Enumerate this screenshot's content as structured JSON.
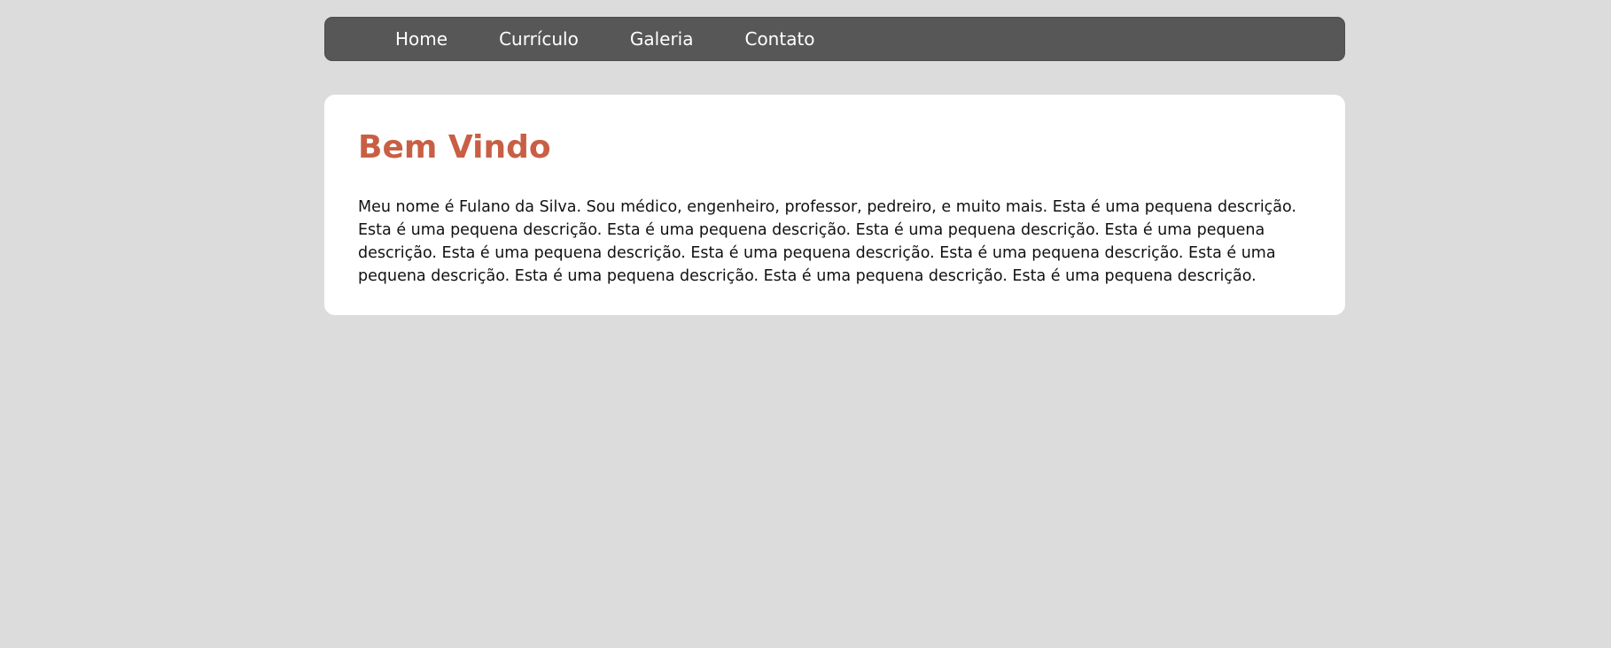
{
  "nav": {
    "items": [
      {
        "label": "Home"
      },
      {
        "label": "Currículo"
      },
      {
        "label": "Galeria"
      },
      {
        "label": "Contato"
      }
    ]
  },
  "main": {
    "title": "Bem Vindo",
    "paragraph": "Meu nome é Fulano da Silva. Sou médico, engenheiro, professor, pedreiro, e muito mais. Esta é uma pequena descrição. Esta é uma pequena descrição. Esta é uma pequena descrição. Esta é uma pequena descrição. Esta é uma pequena descrição. Esta é uma pequena descrição. Esta é uma pequena descrição. Esta é uma pequena descrição. Esta é uma pequena descrição. Esta é uma pequena descrição. Esta é uma pequena descrição. Esta é uma pequena descrição."
  },
  "colors": {
    "background": "#dcdcdc",
    "navbar": "#575757",
    "title": "#c85f44",
    "card": "#ffffff"
  }
}
